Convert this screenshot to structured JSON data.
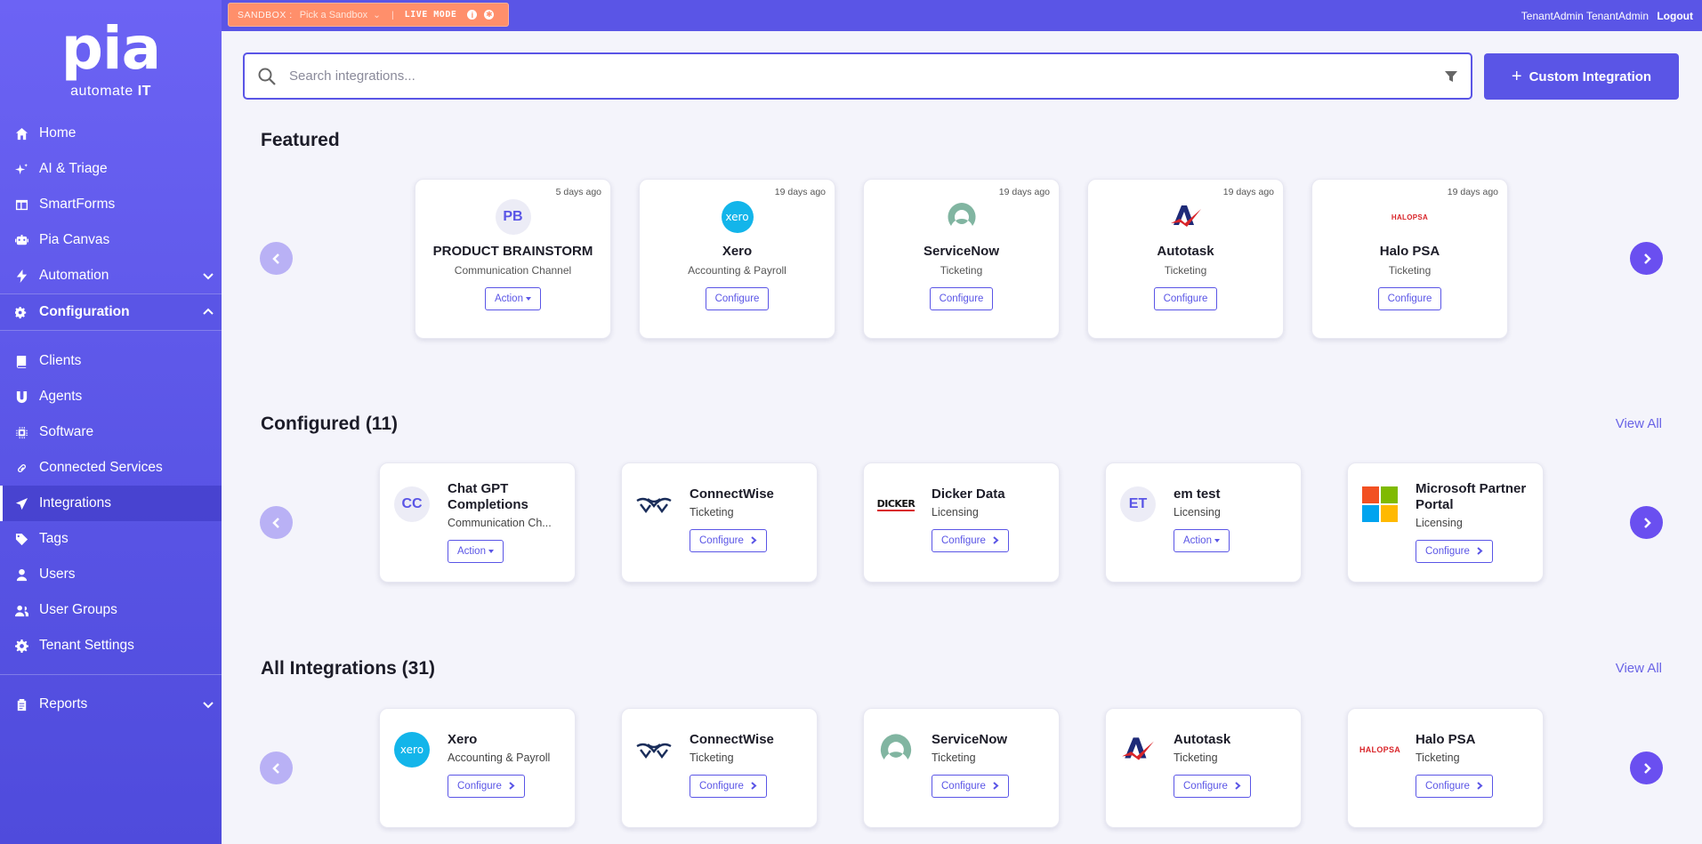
{
  "brand": {
    "logo": "pia",
    "tagline_pre": "automate ",
    "tagline_bold": "IT"
  },
  "sidebar": {
    "items": [
      {
        "label": "Home",
        "icon": "home-icon"
      },
      {
        "label": "AI & Triage",
        "icon": "sparkles-icon"
      },
      {
        "label": "SmartForms",
        "icon": "form-icon"
      },
      {
        "label": "Pia Canvas",
        "icon": "robot-icon"
      },
      {
        "label": "Automation",
        "icon": "bolt-icon"
      },
      {
        "label": "Configuration",
        "icon": "gears-icon"
      },
      {
        "label": "Clients",
        "icon": "book-icon"
      },
      {
        "label": "Agents",
        "icon": "magnet-icon"
      },
      {
        "label": "Software",
        "icon": "chip-icon"
      },
      {
        "label": "Connected Services",
        "icon": "link-icon"
      },
      {
        "label": "Integrations",
        "icon": "send-icon"
      },
      {
        "label": "Tags",
        "icon": "tag-icon"
      },
      {
        "label": "Users",
        "icon": "user-icon"
      },
      {
        "label": "User Groups",
        "icon": "users-icon"
      },
      {
        "label": "Tenant Settings",
        "icon": "gear-icon"
      },
      {
        "label": "Reports",
        "icon": "clipboard-icon"
      }
    ],
    "active": "Integrations"
  },
  "topbar": {
    "sandbox_label": "SANDBOX :",
    "sandbox_picker": "Pick a Sandbox",
    "sandbox_sep": "|",
    "live_mode": "LIVE MODE",
    "user_name": "TenantAdmin TenantAdmin",
    "logout": "Logout"
  },
  "search": {
    "placeholder": "Search integrations..."
  },
  "custom_button": "Custom Integration",
  "featured": {
    "title": "Featured",
    "cards": [
      {
        "date": "5 days ago",
        "name": "PRODUCT BRAINSTORM",
        "category": "Communication Channel",
        "button": "Action",
        "initials": "PB"
      },
      {
        "date": "19 days ago",
        "name": "Xero",
        "category": "Accounting & Payroll",
        "button": "Configure",
        "logo_text": "xero"
      },
      {
        "date": "19 days ago",
        "name": "ServiceNow",
        "category": "Ticketing",
        "button": "Configure"
      },
      {
        "date": "19 days ago",
        "name": "Autotask",
        "category": "Ticketing",
        "button": "Configure"
      },
      {
        "date": "19 days ago",
        "name": "Halo PSA",
        "category": "Ticketing",
        "button": "Configure",
        "logo_text": "HALOPSA"
      }
    ]
  },
  "configured": {
    "title": "Configured (11)",
    "view_all": "View All",
    "cards": [
      {
        "name": "Chat GPT Completions",
        "category": "Communication Ch...",
        "button": "Action",
        "initials": "CC"
      },
      {
        "name": "ConnectWise",
        "category": "Ticketing",
        "button": "Configure"
      },
      {
        "name": "Dicker Data",
        "category": "Licensing",
        "button": "Configure",
        "logo_text": "DICKER"
      },
      {
        "name": "em test",
        "category": "Licensing",
        "button": "Action",
        "initials": "ET"
      },
      {
        "name": "Microsoft Partner Portal",
        "category": "Licensing",
        "button": "Configure"
      }
    ]
  },
  "all": {
    "title": "All Integrations (31)",
    "view_all": "View All",
    "cards": [
      {
        "name": "Xero",
        "category": "Accounting & Payroll",
        "button": "Configure",
        "logo_text": "xero"
      },
      {
        "name": "ConnectWise",
        "category": "Ticketing",
        "button": "Configure"
      },
      {
        "name": "ServiceNow",
        "category": "Ticketing",
        "button": "Configure"
      },
      {
        "name": "Autotask",
        "category": "Ticketing",
        "button": "Configure"
      },
      {
        "name": "Halo PSA",
        "category": "Ticketing",
        "button": "Configure",
        "logo_text": "HALOPSA"
      }
    ]
  },
  "colors": {
    "primary": "#5a55e6",
    "sidebar": "#6c63f4",
    "sandbox": "#ff8f6b",
    "next_arrow": "#6a4ff0",
    "prev_arrow": "#b9b1f5"
  }
}
